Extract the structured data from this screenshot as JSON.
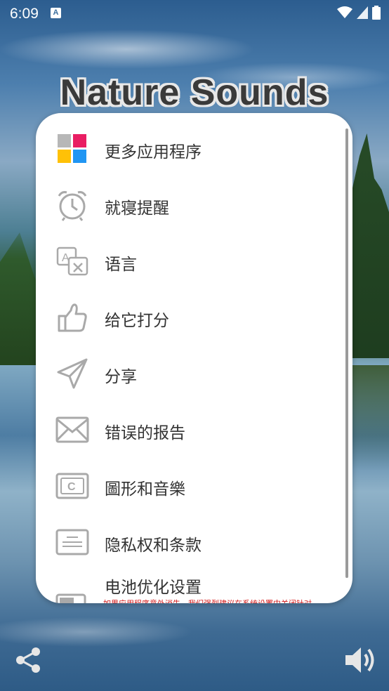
{
  "status_bar": {
    "time": "6:09",
    "notification_icon": "A"
  },
  "app": {
    "title": "Nature Sounds"
  },
  "menu": {
    "items": [
      {
        "label": "更多应用程序",
        "icon": "more-apps-grid-icon"
      },
      {
        "label": "就寝提醒",
        "icon": "alarm-clock-icon"
      },
      {
        "label": "语言",
        "icon": "translate-icon"
      },
      {
        "label": "给它打分",
        "icon": "thumbs-up-icon"
      },
      {
        "label": "分享",
        "icon": "send-icon"
      },
      {
        "label": "错误的报告",
        "icon": "mail-icon"
      },
      {
        "label": "圖形和音樂",
        "icon": "copyright-icon"
      },
      {
        "label": "隐私权和条款",
        "icon": "document-icon"
      },
      {
        "label": "电池优化设置",
        "icon": "battery-icon"
      }
    ],
    "battery_warning": "如果应用程序意外消失，我们强烈建议在系统设置中关闭针对"
  },
  "colors": {
    "grid_gray": "#b7b7b7",
    "grid_pink": "#e91e63",
    "grid_yellow": "#ffc107",
    "grid_blue": "#2196f3",
    "warning_red": "#d21a1a"
  }
}
